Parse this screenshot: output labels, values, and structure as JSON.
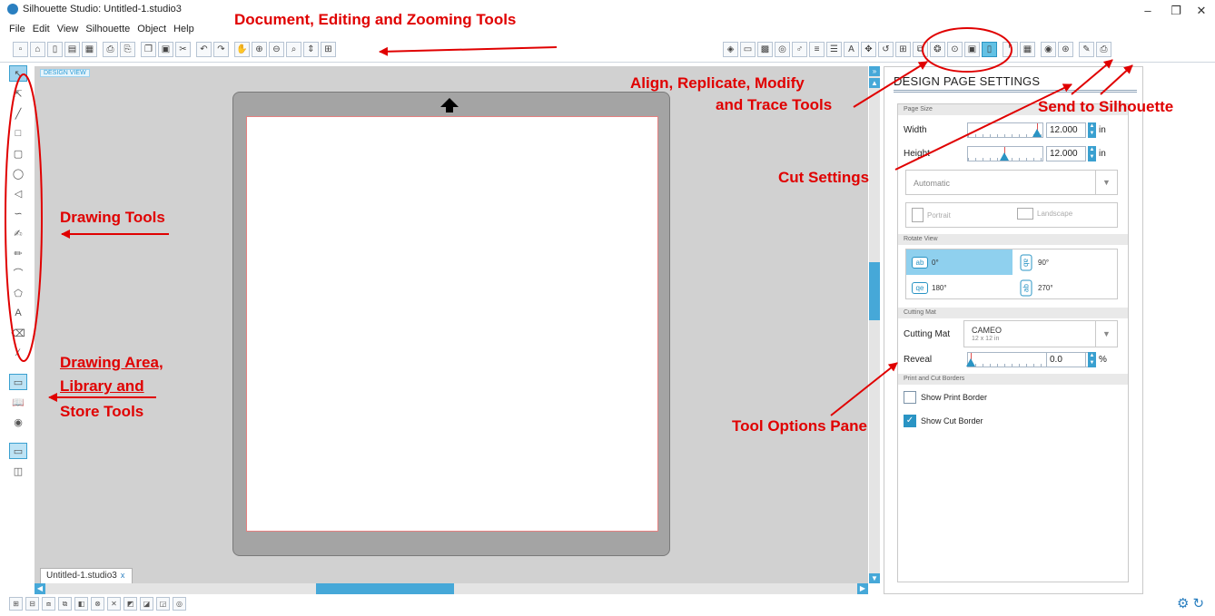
{
  "window": {
    "title": "Silhouette Studio: Untitled-1.studio3",
    "minimize_glyph": "–",
    "restore_glyph": "❐",
    "close_glyph": "✕"
  },
  "menu": [
    "File",
    "Edit",
    "View",
    "Silhouette",
    "Object",
    "Help"
  ],
  "canvas": {
    "view_label": "DESIGN VIEW",
    "doc_tab": "Untitled-1.studio3",
    "doc_tab_close": "x"
  },
  "panel": {
    "title": "DESIGN PAGE SETTINGS",
    "page_size": {
      "section": "Page Size",
      "width_label": "Width",
      "width_value": "12.000",
      "height_label": "Height",
      "height_value": "12.000",
      "unit": "in",
      "preset": "Automatic",
      "portrait": "Portrait",
      "landscape": "Landscape"
    },
    "rotate_view": {
      "section": "Rotate View",
      "options": [
        "0°",
        "90°",
        "180°",
        "270°"
      ],
      "glyphs": [
        "ab",
        "ab",
        "qe",
        "ab"
      ],
      "selected": "0°"
    },
    "cutting_mat": {
      "section": "Cutting Mat",
      "label": "Cutting Mat",
      "value": "CAMEO",
      "sub": "12 x 12 in",
      "reveal_label": "Reveal",
      "reveal_value": "0.0",
      "reveal_unit": "%"
    },
    "borders": {
      "section": "Print and Cut Borders",
      "show_print_border": "Show Print Border",
      "show_print_border_checked": false,
      "show_cut_border": "Show Cut Border",
      "show_cut_border_checked": true
    }
  },
  "annotations": {
    "doc_tools": "Document, Editing and Zooming Tools",
    "align_tools_1": "Align, Replicate, Modify",
    "align_tools_2": "and Trace Tools",
    "send": "Send to Silhouette",
    "cut_settings": "Cut Settings",
    "drawing_tools": "Drawing Tools",
    "drawing_area_1": "Drawing Area,",
    "drawing_area_2": "Library and",
    "drawing_area_3": "Store Tools",
    "tool_options": "Tool Options Pane"
  },
  "colors": {
    "annotation": "#e00000",
    "accent": "#2a94c4",
    "mat": "#a4a4a4",
    "canvas": "#d1d1d1"
  }
}
